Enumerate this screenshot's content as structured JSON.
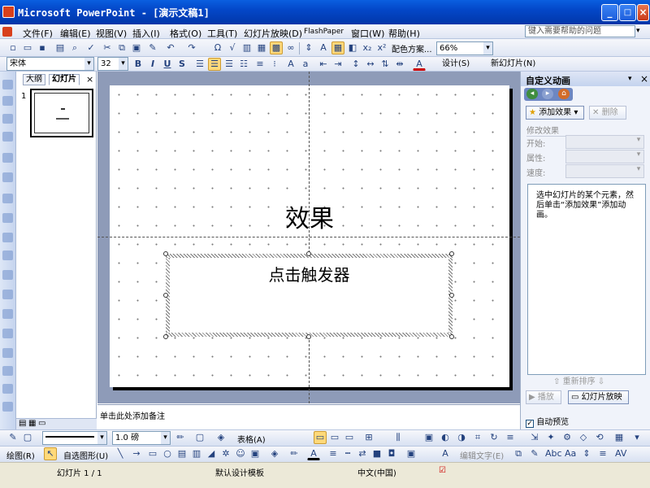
{
  "window": {
    "title": "Microsoft PowerPoint - [演示文稿1]",
    "min": "_",
    "max": "□",
    "close": "×"
  },
  "menubar": {
    "items": [
      "文件(F)",
      "编辑(E)",
      "视图(V)",
      "插入(I)",
      "格式(O)",
      "工具(T)",
      "幻灯片放映(D)",
      "FlashPaper",
      "窗口(W)",
      "帮助(H)"
    ],
    "help_placeholder": "键入需要帮助的问题"
  },
  "toolbar": {
    "color_scheme": "配色方案...",
    "zoom": "66%"
  },
  "format": {
    "font": "宋体",
    "size": "32",
    "bold": "B",
    "italic": "I",
    "underline": "U",
    "shadow": "S",
    "design": "设计(S)",
    "new_slide": "新幻灯片(N)"
  },
  "panel": {
    "tabs": [
      "大纲",
      "幻灯片"
    ],
    "slide_num": "1"
  },
  "slide": {
    "title": "效果",
    "trigger": "点击触发器"
  },
  "notes": {
    "placeholder": "单击此处添加备注"
  },
  "taskpane": {
    "title": "自定义动画",
    "add_effect": "添加效果",
    "delete": "删除",
    "modify": "修改效果",
    "start": "开始:",
    "property": "属性:",
    "speed": "速度:",
    "hint": "选中幻灯片的某个元素，然后单击“添加效果”添加动画。",
    "reorder": "重新排序",
    "play": "播放",
    "slideshow": "幻灯片放映",
    "autopreview": "自动预览"
  },
  "draw1": {
    "line_weight": "1.0 磅",
    "table": "表格(A)"
  },
  "draw2": {
    "draw": "绘图(R)",
    "autoshape": "自选图形(U)",
    "edit_text": "编辑文字(E)"
  },
  "status": {
    "slide": "幻灯片 1 / 1",
    "design": "默认设计模板",
    "lang": "中文(中国)"
  }
}
